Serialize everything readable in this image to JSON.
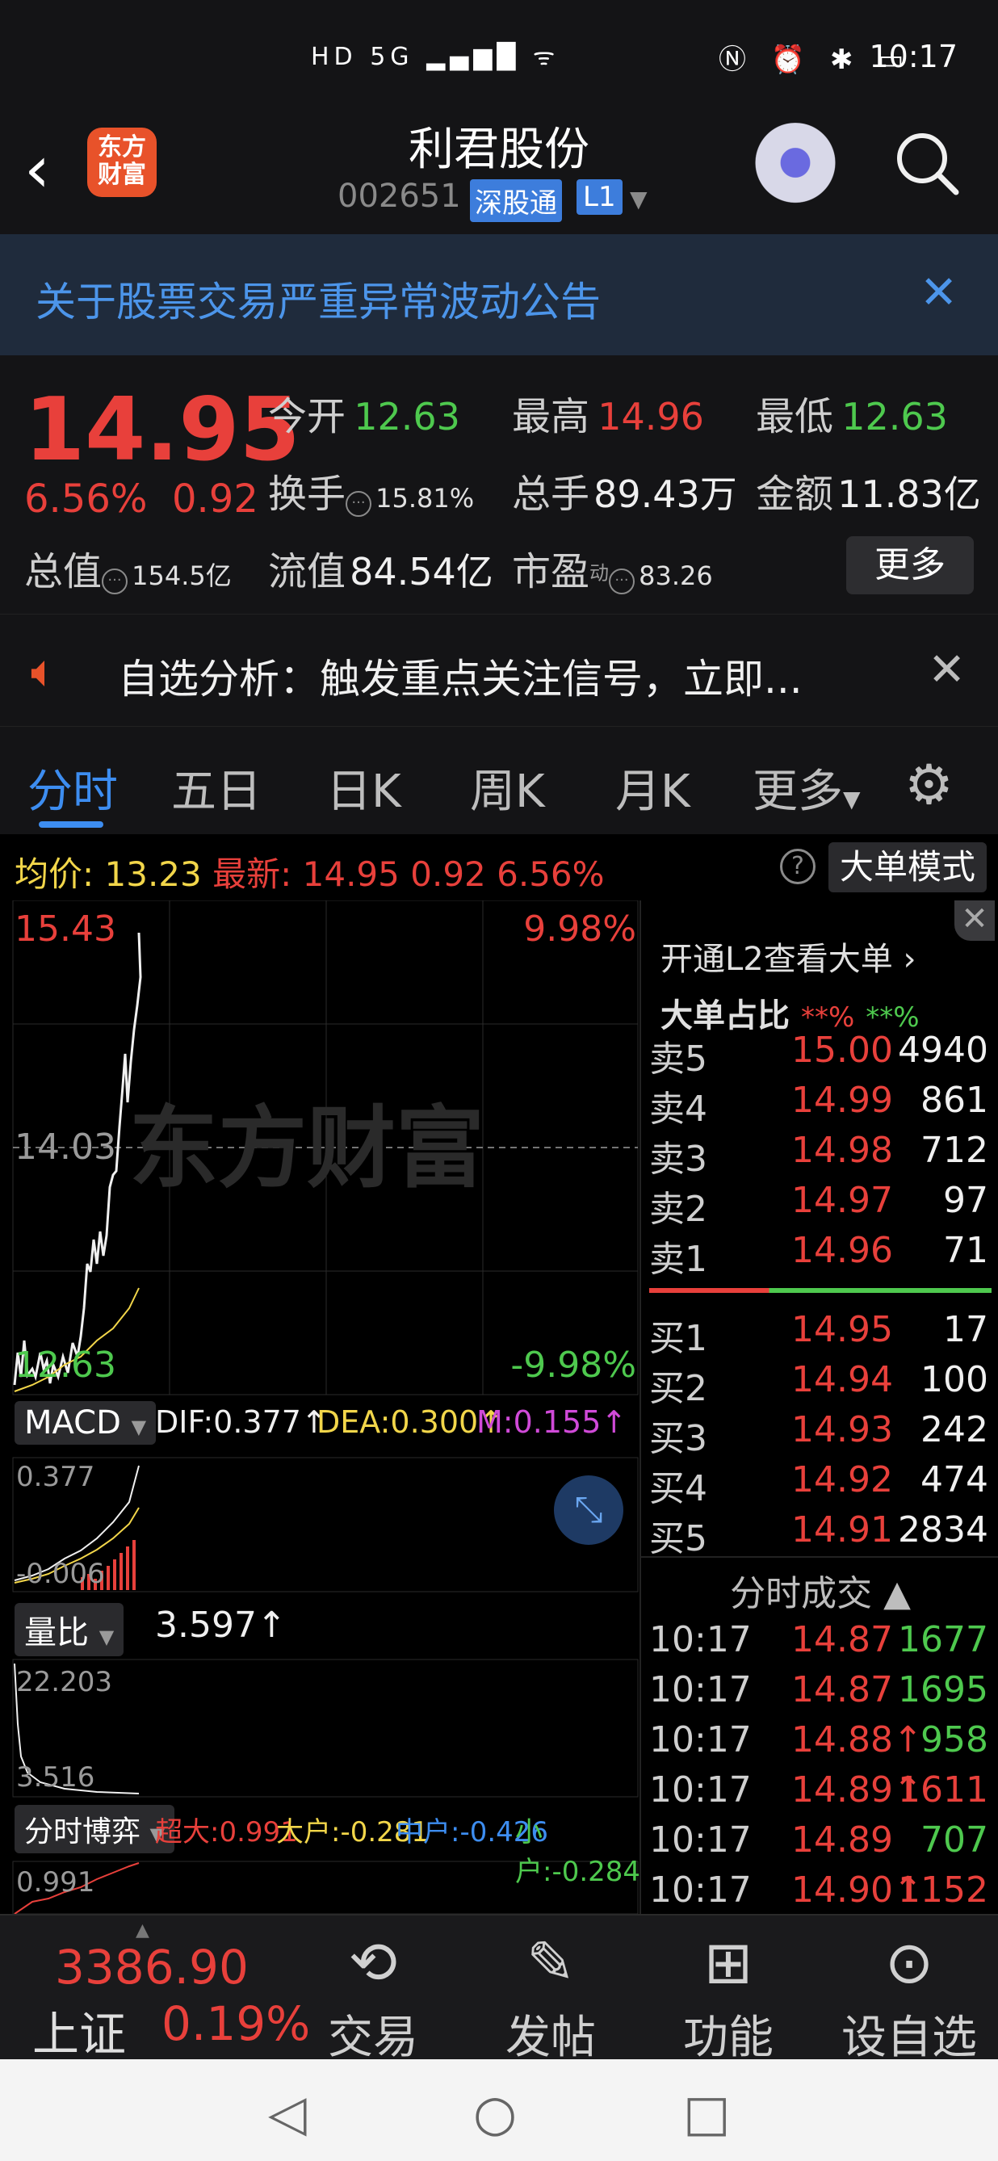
{
  "status_bar": {
    "left_icons": "HD 5G ▂▄▆█ ᯤ",
    "right_icons": "Ⓝ ⏰ ✱ ▭",
    "time": "10:17"
  },
  "header": {
    "logo_text": "东方\n财富",
    "stock_name": "利君股份",
    "stock_code": "002651",
    "tag_connect": "深股通",
    "tag_level": "L1"
  },
  "notice": {
    "text": "关于股票交易严重异常波动公告"
  },
  "quote": {
    "price": "14.95",
    "change_pct": "6.56%",
    "change": "0.92",
    "open_label": "今开",
    "open": "12.63",
    "high_label": "最高",
    "high": "14.96",
    "low_label": "最低",
    "low": "12.63",
    "turnover_label": "换手",
    "turnover": "15.81%",
    "volume_label": "总手",
    "volume": "89.43万",
    "amount_label": "金额",
    "amount": "11.83亿",
    "mktcap_label": "总值",
    "mktcap": "154.5亿",
    "float_label": "流值",
    "float": "84.54亿",
    "pe_label": "市盈",
    "pe_sup": "动",
    "pe": "83.26",
    "more_label": "更多"
  },
  "analysis": {
    "text": "自选分析：触发重点关注信号，立即..."
  },
  "tabs": [
    "分时",
    "五日",
    "日K",
    "周K",
    "月K",
    "更多"
  ],
  "price_line": {
    "avg_label": "均价:",
    "avg": "13.23",
    "latest_label": "最新:",
    "latest": "14.95",
    "chg": "0.92",
    "pct": "6.56%",
    "mode_label": "大单模式"
  },
  "chart": {
    "top_price": "15.43",
    "top_pct": "9.98%",
    "mid_price": "14.03",
    "bot_price": "12.63",
    "bot_pct": "-9.98%",
    "watermark": "东方财富",
    "macd_btn": "MACD",
    "dif": "DIF:0.377↑",
    "dea": "DEA:0.300↑",
    "m": "M:0.155↑",
    "macd_top": "0.377",
    "macd_bot": "-0.006",
    "lb_btn": "量比",
    "lb_val": "3.597↑",
    "lb_top": "22.203",
    "lb_bot": "3.516",
    "fs_btn": "分时博弈",
    "cd": "超大:0.991",
    "dh": "大户:-0.281",
    "zh": "中户:-0.426",
    "xh": "小户:-0.284",
    "fs_top": "0.991"
  },
  "book": {
    "l2_text": "开通L2查看大单 ›",
    "ratio_label": "大单占比",
    "ratio_red": "**%",
    "ratio_green": "**%",
    "asks": [
      {
        "label": "卖5",
        "price": "15.00",
        "vol": "4940"
      },
      {
        "label": "卖4",
        "price": "14.99",
        "vol": "861"
      },
      {
        "label": "卖3",
        "price": "14.98",
        "vol": "712"
      },
      {
        "label": "卖2",
        "price": "14.97",
        "vol": "97"
      },
      {
        "label": "卖1",
        "price": "14.96",
        "vol": "71"
      }
    ],
    "bids": [
      {
        "label": "买1",
        "price": "14.95",
        "vol": "17"
      },
      {
        "label": "买2",
        "price": "14.94",
        "vol": "100"
      },
      {
        "label": "买3",
        "price": "14.93",
        "vol": "242"
      },
      {
        "label": "买4",
        "price": "14.92",
        "vol": "474"
      },
      {
        "label": "买5",
        "price": "14.91",
        "vol": "2834"
      }
    ],
    "ticks_title": "分时成交 ▲",
    "ticks": [
      {
        "time": "10:17",
        "price": "14.87",
        "vol": "1677"
      },
      {
        "time": "10:17",
        "price": "14.87",
        "vol": "1695"
      },
      {
        "time": "10:17",
        "price": "14.88↑",
        "vol": "958"
      },
      {
        "time": "10:17",
        "price": "14.89↑",
        "vol": "1611"
      },
      {
        "time": "10:17",
        "price": "14.89",
        "vol": "707"
      },
      {
        "time": "10:17",
        "price": "14.90↑",
        "vol": "1152"
      }
    ]
  },
  "bottom": {
    "index_value": "3386.90",
    "index_name": "上证",
    "index_pct": "0.19%",
    "nav": [
      "交易",
      "发帖",
      "功能",
      "设自选"
    ]
  },
  "colors": {
    "up": "#e8403b",
    "down": "#4ec94e",
    "accent": "#3d8df0"
  }
}
